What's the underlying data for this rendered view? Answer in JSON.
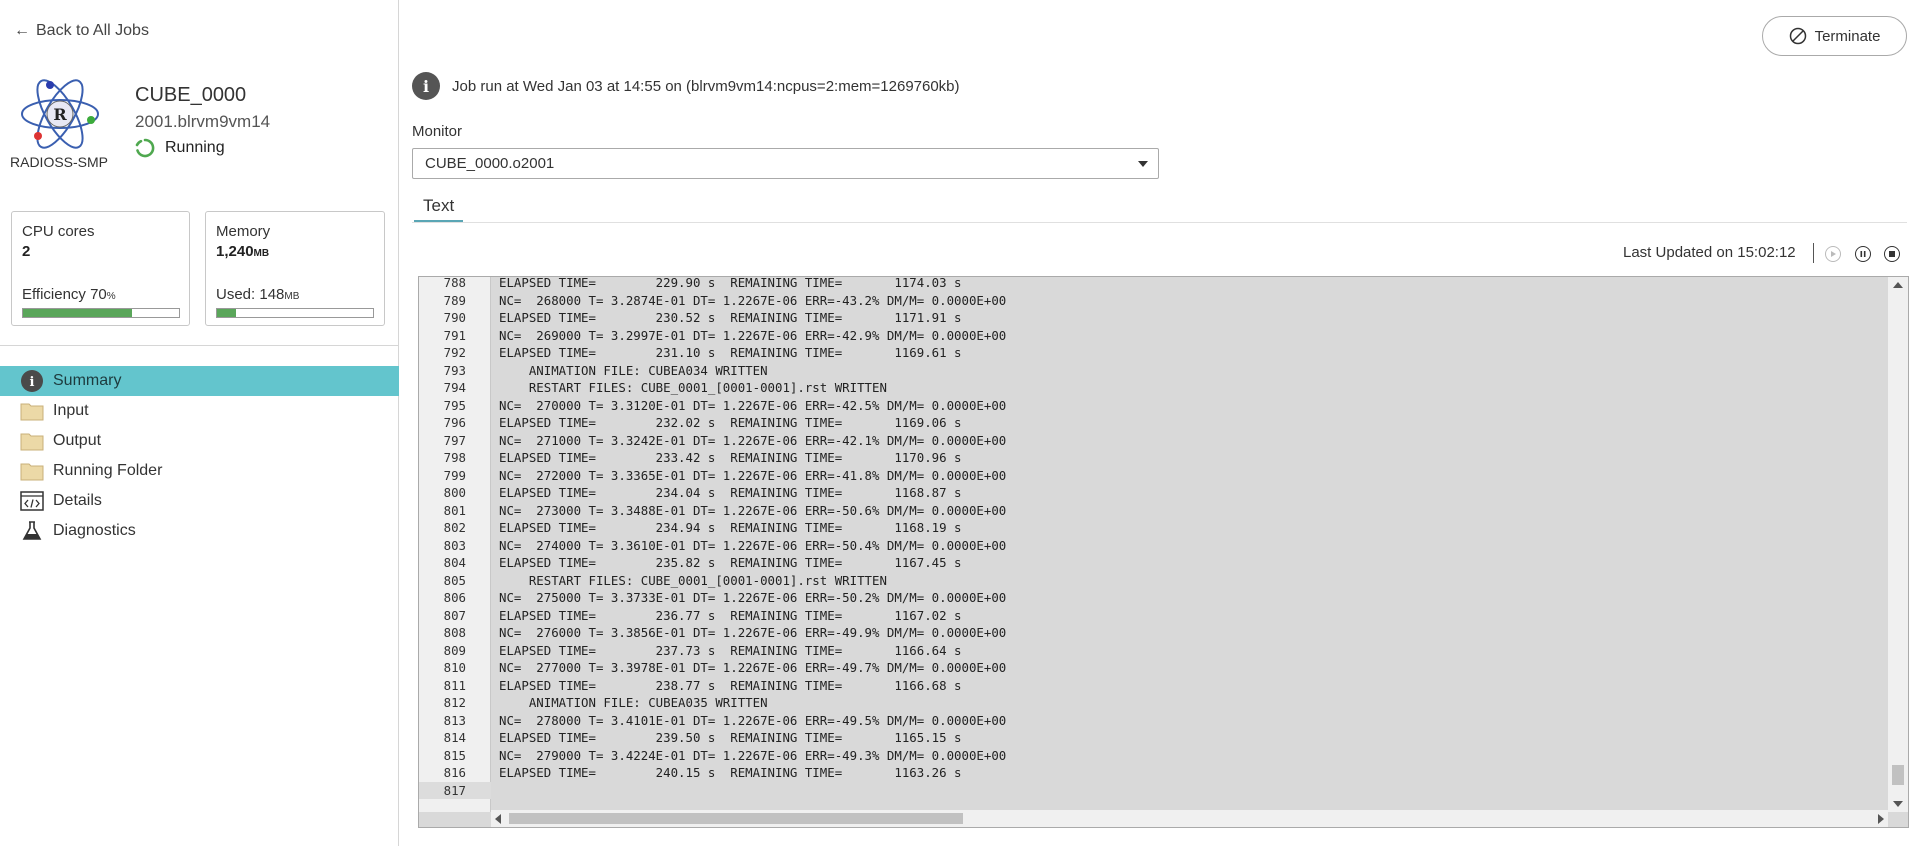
{
  "nav": {
    "back_label": "Back to All Jobs"
  },
  "job": {
    "title": "CUBE_0000",
    "id": "2001.blrvm9vm14",
    "status": "Running",
    "solver": "RADIOSS-SMP"
  },
  "stats": {
    "cpu": {
      "label": "CPU cores",
      "value": "2",
      "efficiency_label": "Efficiency 70",
      "efficiency_unit": "%",
      "efficiency_fraction": 0.7
    },
    "memory": {
      "label": "Memory",
      "value": "1,240",
      "unit": "MB",
      "used_label": "Used: 148",
      "used_unit": "MB",
      "used_fraction": 0.1193
    }
  },
  "sidebar": {
    "items": [
      {
        "label": "Summary",
        "icon": "info-icon",
        "active": true
      },
      {
        "label": "Input",
        "icon": "folder-icon",
        "active": false
      },
      {
        "label": "Output",
        "icon": "folder-icon",
        "active": false
      },
      {
        "label": "Running Folder",
        "icon": "folder-icon",
        "active": false
      },
      {
        "label": "Details",
        "icon": "code-icon",
        "active": false
      },
      {
        "label": "Diagnostics",
        "icon": "flask-icon",
        "active": false
      }
    ]
  },
  "header": {
    "terminate_label": "Terminate",
    "info_text": "Job run at Wed Jan 03 at 14:55 on (blrvm9vm14:ncpus=2:mem=1269760kb)"
  },
  "monitor": {
    "label": "Monitor",
    "selected": "CUBE_0000.o2001"
  },
  "tabs": {
    "text_label": "Text"
  },
  "updated": {
    "label": "Last Updated on 15:02:12"
  },
  "log": {
    "lines": [
      {
        "n": "788",
        "t": "ELAPSED TIME=        229.90 s  REMAINING TIME=       1174.03 s"
      },
      {
        "n": "789",
        "t": "NC=  268000 T= 3.2874E-01 DT= 1.2267E-06 ERR=-43.2% DM/M= 0.0000E+00"
      },
      {
        "n": "790",
        "t": "ELAPSED TIME=        230.52 s  REMAINING TIME=       1171.91 s"
      },
      {
        "n": "791",
        "t": "NC=  269000 T= 3.2997E-01 DT= 1.2267E-06 ERR=-42.9% DM/M= 0.0000E+00"
      },
      {
        "n": "792",
        "t": "ELAPSED TIME=        231.10 s  REMAINING TIME=       1169.61 s"
      },
      {
        "n": "793",
        "t": "    ANIMATION FILE: CUBEA034 WRITTEN"
      },
      {
        "n": "794",
        "t": "    RESTART FILES: CUBE_0001_[0001-0001].rst WRITTEN"
      },
      {
        "n": "795",
        "t": "NC=  270000 T= 3.3120E-01 DT= 1.2267E-06 ERR=-42.5% DM/M= 0.0000E+00"
      },
      {
        "n": "796",
        "t": "ELAPSED TIME=        232.02 s  REMAINING TIME=       1169.06 s"
      },
      {
        "n": "797",
        "t": "NC=  271000 T= 3.3242E-01 DT= 1.2267E-06 ERR=-42.1% DM/M= 0.0000E+00"
      },
      {
        "n": "798",
        "t": "ELAPSED TIME=        233.42 s  REMAINING TIME=       1170.96 s"
      },
      {
        "n": "799",
        "t": "NC=  272000 T= 3.3365E-01 DT= 1.2267E-06 ERR=-41.8% DM/M= 0.0000E+00"
      },
      {
        "n": "800",
        "t": "ELAPSED TIME=        234.04 s  REMAINING TIME=       1168.87 s"
      },
      {
        "n": "801",
        "t": "NC=  273000 T= 3.3488E-01 DT= 1.2267E-06 ERR=-50.6% DM/M= 0.0000E+00"
      },
      {
        "n": "802",
        "t": "ELAPSED TIME=        234.94 s  REMAINING TIME=       1168.19 s"
      },
      {
        "n": "803",
        "t": "NC=  274000 T= 3.3610E-01 DT= 1.2267E-06 ERR=-50.4% DM/M= 0.0000E+00"
      },
      {
        "n": "804",
        "t": "ELAPSED TIME=        235.82 s  REMAINING TIME=       1167.45 s"
      },
      {
        "n": "805",
        "t": "    RESTART FILES: CUBE_0001_[0001-0001].rst WRITTEN"
      },
      {
        "n": "806",
        "t": "NC=  275000 T= 3.3733E-01 DT= 1.2267E-06 ERR=-50.2% DM/M= 0.0000E+00"
      },
      {
        "n": "807",
        "t": "ELAPSED TIME=        236.77 s  REMAINING TIME=       1167.02 s"
      },
      {
        "n": "808",
        "t": "NC=  276000 T= 3.3856E-01 DT= 1.2267E-06 ERR=-49.9% DM/M= 0.0000E+00"
      },
      {
        "n": "809",
        "t": "ELAPSED TIME=        237.73 s  REMAINING TIME=       1166.64 s"
      },
      {
        "n": "810",
        "t": "NC=  277000 T= 3.3978E-01 DT= 1.2267E-06 ERR=-49.7% DM/M= 0.0000E+00"
      },
      {
        "n": "811",
        "t": "ELAPSED TIME=        238.77 s  REMAINING TIME=       1166.68 s"
      },
      {
        "n": "812",
        "t": "    ANIMATION FILE: CUBEA035 WRITTEN"
      },
      {
        "n": "813",
        "t": "NC=  278000 T= 3.4101E-01 DT= 1.2267E-06 ERR=-49.5% DM/M= 0.0000E+00"
      },
      {
        "n": "814",
        "t": "ELAPSED TIME=        239.50 s  REMAINING TIME=       1165.15 s"
      },
      {
        "n": "815",
        "t": "NC=  279000 T= 3.4224E-01 DT= 1.2267E-06 ERR=-49.3% DM/M= 0.0000E+00"
      },
      {
        "n": "816",
        "t": "ELAPSED TIME=        240.15 s  REMAINING TIME=       1163.26 s"
      },
      {
        "n": "817",
        "t": ""
      }
    ]
  },
  "colors": {
    "accent": "#63c5cd",
    "bar": "#5aa65a",
    "log_bg": "#d9d9d9"
  }
}
